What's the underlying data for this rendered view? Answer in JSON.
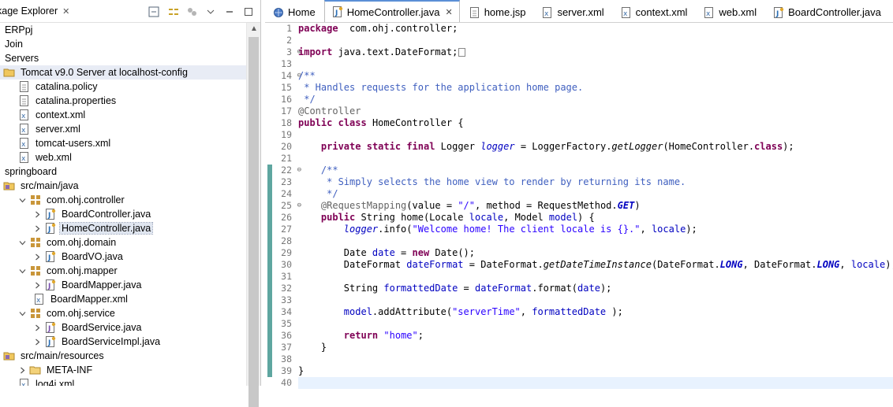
{
  "explorer": {
    "title": "kage Explorer",
    "tree": [
      {
        "label": "ERPpj",
        "indent": 0,
        "icon": "none",
        "twisty": ""
      },
      {
        "label": "Join",
        "indent": 0,
        "icon": "none",
        "twisty": ""
      },
      {
        "label": "Servers",
        "indent": 0,
        "icon": "none",
        "twisty": ""
      },
      {
        "label": "Tomcat v9.0 Server at localhost-config",
        "indent": 0,
        "icon": "folder-open-icon",
        "twisty": "",
        "highlight": true
      },
      {
        "label": "catalina.policy",
        "indent": 1,
        "icon": "file-icon",
        "twisty": ""
      },
      {
        "label": "catalina.properties",
        "indent": 1,
        "icon": "file-icon",
        "twisty": ""
      },
      {
        "label": "context.xml",
        "indent": 1,
        "icon": "xml-file-icon",
        "twisty": ""
      },
      {
        "label": "server.xml",
        "indent": 1,
        "icon": "xml-file-icon",
        "twisty": ""
      },
      {
        "label": "tomcat-users.xml",
        "indent": 1,
        "icon": "xml-file-icon",
        "twisty": ""
      },
      {
        "label": "web.xml",
        "indent": 1,
        "icon": "xml-file-icon",
        "twisty": ""
      },
      {
        "label": "springboard",
        "indent": 0,
        "icon": "none",
        "twisty": ""
      },
      {
        "label": "src/main/java",
        "indent": 0,
        "icon": "source-folder-icon",
        "twisty": ""
      },
      {
        "label": "com.ohj.controller",
        "indent": 1,
        "icon": "package-icon",
        "twisty": "v"
      },
      {
        "label": "BoardController.java",
        "indent": 2,
        "icon": "java-file-icon",
        "twisty": ">"
      },
      {
        "label": "HomeController.java",
        "indent": 2,
        "icon": "java-file-icon",
        "twisty": ">",
        "selected": true
      },
      {
        "label": "com.ohj.domain",
        "indent": 1,
        "icon": "package-icon",
        "twisty": "v"
      },
      {
        "label": "BoardVO.java",
        "indent": 2,
        "icon": "java-file-icon",
        "twisty": ">"
      },
      {
        "label": "com.ohj.mapper",
        "indent": 1,
        "icon": "package-icon",
        "twisty": "v"
      },
      {
        "label": "BoardMapper.java",
        "indent": 2,
        "icon": "java-interface-icon",
        "twisty": ">"
      },
      {
        "label": "BoardMapper.xml",
        "indent": 2,
        "icon": "xml-file-icon",
        "twisty": ""
      },
      {
        "label": "com.ohj.service",
        "indent": 1,
        "icon": "package-icon",
        "twisty": "v"
      },
      {
        "label": "BoardService.java",
        "indent": 2,
        "icon": "java-interface-icon",
        "twisty": ">"
      },
      {
        "label": "BoardServiceImpl.java",
        "indent": 2,
        "icon": "java-file-icon",
        "twisty": ">"
      },
      {
        "label": "src/main/resources",
        "indent": 0,
        "icon": "source-folder-icon",
        "twisty": ""
      },
      {
        "label": "META-INF",
        "indent": 1,
        "icon": "folder-icon",
        "twisty": ">"
      },
      {
        "label": "log4j.xml",
        "indent": 1,
        "icon": "xml-file-icon",
        "twisty": ""
      }
    ]
  },
  "editor": {
    "tabs": [
      {
        "label": "Home",
        "icon": "globe-icon",
        "active": false
      },
      {
        "label": "HomeController.java",
        "icon": "java-file-icon",
        "active": true,
        "closable": true
      },
      {
        "label": "home.jsp",
        "icon": "file-icon",
        "active": false
      },
      {
        "label": "server.xml",
        "icon": "xml-file-icon",
        "active": false
      },
      {
        "label": "context.xml",
        "icon": "xml-file-icon",
        "active": false
      },
      {
        "label": "web.xml",
        "icon": "xml-file-icon",
        "active": false
      },
      {
        "label": "BoardController.java",
        "icon": "java-file-icon",
        "active": false
      }
    ],
    "line_numbers": [
      "1",
      "2",
      "3",
      "13",
      "14",
      "15",
      "16",
      "17",
      "18",
      "19",
      "20",
      "21",
      "22",
      "23",
      "24",
      "25",
      "26",
      "27",
      "28",
      "29",
      "30",
      "31",
      "32",
      "33",
      "34",
      "35",
      "36",
      "37",
      "38",
      "39",
      "40"
    ],
    "code": [
      [
        [
          "kw",
          "package"
        ],
        [
          "",
          "  com.ohj.controller;"
        ]
      ],
      [],
      [
        [
          "kw",
          "import"
        ],
        [
          "",
          " java.text.DateFormat;"
        ]
      ],
      [],
      [
        [
          "cm",
          "/**"
        ]
      ],
      [
        [
          "cm",
          " * Handles requests for the application home page."
        ]
      ],
      [
        [
          "cm",
          " */"
        ]
      ],
      [
        [
          "ann",
          "@Controller"
        ]
      ],
      [
        [
          "kw",
          "public"
        ],
        [
          "",
          " "
        ],
        [
          "kw",
          "class"
        ],
        [
          "",
          " HomeController {"
        ]
      ],
      [],
      [
        [
          "",
          "    "
        ],
        [
          "kw",
          "private"
        ],
        [
          "",
          " "
        ],
        [
          "kw",
          "static"
        ],
        [
          "",
          " "
        ],
        [
          "kw",
          "final"
        ],
        [
          "",
          " Logger "
        ],
        [
          "fld",
          "logger"
        ],
        [
          "",
          " = LoggerFactory."
        ],
        [
          "itl",
          "getLogger"
        ],
        [
          "",
          "(HomeController."
        ],
        [
          "kw",
          "class"
        ],
        [
          "",
          ");"
        ]
      ],
      [],
      [
        [
          "",
          "    "
        ],
        [
          "cm",
          "/**"
        ]
      ],
      [
        [
          "cm",
          "     * Simply selects the home view to render by returning its name."
        ]
      ],
      [
        [
          "cm",
          "     */"
        ]
      ],
      [
        [
          "",
          "    "
        ],
        [
          "ann",
          "@RequestMapping"
        ],
        [
          "",
          "(value = "
        ],
        [
          "str",
          "\"/\""
        ],
        [
          "",
          ", method = RequestMethod."
        ],
        [
          "cst",
          "GET"
        ],
        [
          "",
          ")"
        ]
      ],
      [
        [
          "",
          "    "
        ],
        [
          "kw",
          "public"
        ],
        [
          "",
          " String home(Locale "
        ],
        [
          "fldv",
          "locale"
        ],
        [
          "",
          ", Model "
        ],
        [
          "fldv",
          "model"
        ],
        [
          "",
          ") {"
        ]
      ],
      [
        [
          "",
          "        "
        ],
        [
          "fld",
          "logger"
        ],
        [
          "",
          ".info("
        ],
        [
          "str",
          "\"Welcome home! The client locale is {}.\""
        ],
        [
          "",
          ", "
        ],
        [
          "fldv",
          "locale"
        ],
        [
          "",
          ");"
        ]
      ],
      [],
      [
        [
          "",
          "        Date "
        ],
        [
          "fldv",
          "date"
        ],
        [
          "",
          " = "
        ],
        [
          "kw",
          "new"
        ],
        [
          "",
          " Date();"
        ]
      ],
      [
        [
          "",
          "        DateFormat "
        ],
        [
          "fldv",
          "dateFormat"
        ],
        [
          "",
          " = DateFormat."
        ],
        [
          "itl",
          "getDateTimeInstance"
        ],
        [
          "",
          "(DateFormat."
        ],
        [
          "cst",
          "LONG"
        ],
        [
          "",
          ", DateFormat."
        ],
        [
          "cst",
          "LONG"
        ],
        [
          "",
          ", "
        ],
        [
          "fldv",
          "locale"
        ],
        [
          "",
          ");"
        ]
      ],
      [],
      [
        [
          "",
          "        String "
        ],
        [
          "fldv",
          "formattedDate"
        ],
        [
          "",
          " = "
        ],
        [
          "fldv",
          "dateFormat"
        ],
        [
          "",
          ".format("
        ],
        [
          "fldv",
          "date"
        ],
        [
          "",
          ");"
        ]
      ],
      [],
      [
        [
          "",
          "        "
        ],
        [
          "fldv",
          "model"
        ],
        [
          "",
          ".addAttribute("
        ],
        [
          "str",
          "\"serverTime\""
        ],
        [
          "",
          ", "
        ],
        [
          "fldv",
          "formattedDate"
        ],
        [
          "",
          " );"
        ]
      ],
      [],
      [
        [
          "",
          "        "
        ],
        [
          "kw",
          "return"
        ],
        [
          "",
          " "
        ],
        [
          "str",
          "\"home\""
        ],
        [
          "",
          ";"
        ]
      ],
      [
        [
          "",
          "    }"
        ]
      ],
      [],
      [
        [
          "",
          "}"
        ]
      ],
      []
    ],
    "folded_lines": [
      "3",
      "14",
      "22",
      "25"
    ]
  }
}
